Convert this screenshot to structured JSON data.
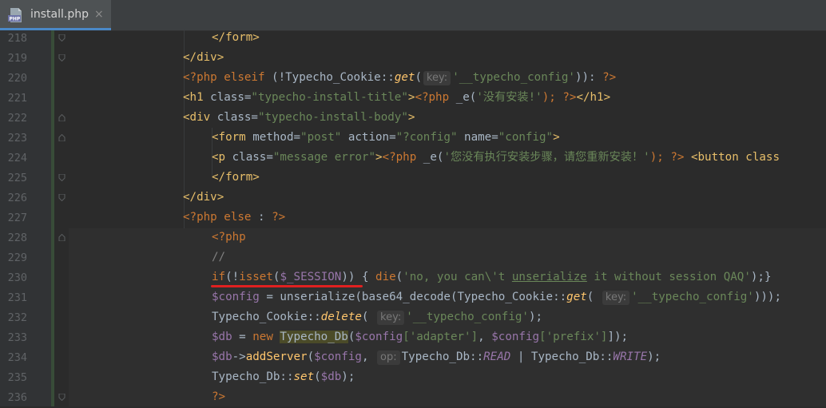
{
  "tab": {
    "title": "install.php",
    "close": "×",
    "icon": "php-file-icon"
  },
  "line_numbers": [
    "218",
    "219",
    "220",
    "221",
    "222",
    "223",
    "224",
    "225",
    "226",
    "227",
    "228",
    "229",
    "230",
    "231",
    "232",
    "233",
    "234",
    "235",
    "236"
  ],
  "code": {
    "l218": {
      "text": "</form>"
    },
    "l219": {
      "text": "</div>"
    },
    "l220": {
      "open": "<?php",
      "elseif": "elseif",
      "p1": " (!Typecho_Cookie::",
      "get": "get",
      "paren": "(",
      "hint": "key:",
      "str": "'__typecho_config'",
      "close": ")): ",
      "end": "?>"
    },
    "l221": {
      "tag1": "<h1 ",
      "attr": "class=",
      "val": "\"typecho-install-title\"",
      "gt": ">",
      "php": "<?php",
      "call": " _e(",
      "str": "'没有安装!'",
      "semi": "); ",
      "end": "?>",
      "tag2": "</h1>"
    },
    "l222": {
      "tag1": "<div ",
      "attr": "class=",
      "val": "\"typecho-install-body\"",
      "gt": ">"
    },
    "l223": {
      "tag1": "<form ",
      "a1": "method=",
      "v1": "\"post\"",
      "a2": " action=",
      "v2": "\"?config\"",
      "a3": " name=",
      "v3": "\"config\"",
      "gt": ">"
    },
    "l224": {
      "tag1": "<p ",
      "attr": "class=",
      "val": "\"message error\"",
      "gt": ">",
      "php": "<?php",
      "call": " _e(",
      "str": "'您没有执行安装步骤，请您重新安装！'",
      "semi": "); ",
      "end": "?>",
      "tag2": " <button class"
    },
    "l225": {
      "text": "</form>"
    },
    "l226": {
      "text": "</div>"
    },
    "l227": {
      "open": "<?php",
      "else": " else",
      "colon": " : ",
      "end": "?>"
    },
    "l228": {
      "text": "<?php"
    },
    "l229": {
      "text": "//"
    },
    "l230": {
      "if": "if",
      "p1": "(!",
      "isset": "isset",
      "p2": "(",
      "var": "$_SESSION",
      "p3": ")) { ",
      "die": "die",
      "p4": "(",
      "s1": "'no, you can\\'t ",
      "s2": "unserialize",
      "s3": " it without session QAQ'",
      "p5": ");}"
    },
    "l231": {
      "var": "$config",
      "p1": " = unserialize(base64_decode(Typecho_Cookie::",
      "get": "get",
      "p2": "( ",
      "hint": "key:",
      "str": "'__typecho_config'",
      "p3": ")));"
    },
    "l232": {
      "p1": "Typecho_Cookie::",
      "fn": "delete",
      "p2": "( ",
      "hint": "key:",
      "str": "'__typecho_config'",
      "p3": ");"
    },
    "l233": {
      "var1": "$db",
      "p1": " = ",
      "new": "new",
      "cls": "Typecho_Db",
      "p2": "(",
      "var2": "$config",
      "s1": "['adapter']",
      "p3": ", ",
      "var3": "$config",
      "s2": "['prefix']",
      "p4": "]);"
    },
    "l234": {
      "var1": "$db",
      "arrow": "->",
      "fn": "addServer",
      "p1": "(",
      "var2": "$config",
      "p2": ", ",
      "hint": "op:",
      "p3": "Typecho_Db::",
      "c1": "READ",
      "p4": " | Typecho_Db::",
      "c2": "WRITE",
      "p5": ");"
    },
    "l235": {
      "p1": "Typecho_Db::",
      "fn": "set",
      "p2": "(",
      "var": "$db",
      "p3": ");"
    },
    "l236": {
      "text": "?>"
    }
  },
  "colors": {
    "background": "#2b2b2b",
    "keyword": "#cc7832",
    "tag": "#e8bf6a",
    "string": "#6a8759",
    "variable": "#9876aa",
    "function": "#ffc66d",
    "annotation_underline": "#e02020"
  }
}
